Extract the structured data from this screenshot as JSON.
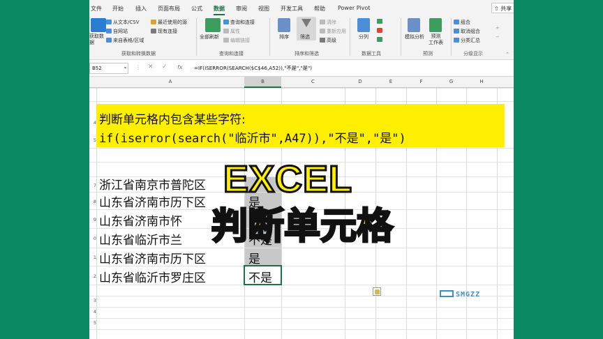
{
  "ribbon_tabs": [
    "文件",
    "开始",
    "插入",
    "页面布局",
    "公式",
    "数据",
    "审阅",
    "视图",
    "开发工具",
    "帮助",
    "Power Pivot"
  ],
  "active_tab": "数据",
  "share_label": "共享",
  "ribbon": {
    "get_data_big": "获取数\n据",
    "from_text_csv": "从文本/CSV",
    "from_web": "自网站",
    "from_table": "来自表格/区域",
    "recent_sources": "最近使用的源",
    "existing_connections": "现有连接",
    "group_get_transform": "获取和转换数据",
    "refresh_all": "全部刷新",
    "queries_connections": "查询和连接",
    "properties": "属性",
    "edit_links": "编辑链接",
    "group_queries": "查询和连接",
    "sort": "排序",
    "filter": "筛选",
    "clear": "清除",
    "reapply": "重新应用",
    "advanced": "高级",
    "group_sort_filter": "排序和筛选",
    "text_to_columns": "分列",
    "group_data_tools": "数据工具",
    "what_if": "模拟分析",
    "forecast_sheet": "预测\n工作表",
    "group_forecast": "预测",
    "group": "组合",
    "ungroup": "取消组合",
    "subtotal": "分类汇总",
    "group_outline": "分级显示"
  },
  "name_box": "B52",
  "formula_bar": {
    "fx": "fx",
    "formula": "=IF(ISERROR(SEARCH($C$46,A52)),\"不是\",\"是\")"
  },
  "columns": [
    "A",
    "B",
    "C",
    "D",
    "E",
    "F",
    "G",
    "H"
  ],
  "row_numbers": [
    "4",
    "5",
    "7",
    "8",
    "9",
    "0",
    "1",
    "2",
    "3",
    "4",
    "5"
  ],
  "yellow_line1": "判断单元格内包含某些字符:",
  "yellow_line2": "if(iserror(search(\"临沂市\",A47)),\"不是\",\"是\")",
  "rows": [
    {
      "a": "浙江省南京市普陀区",
      "b": ""
    },
    {
      "a": "山东省济南市历下区",
      "b": "是"
    },
    {
      "a": "山东省济南市怀",
      "b": ""
    },
    {
      "a": "山东省临沂市兰",
      "b": "不是"
    },
    {
      "a": "山东省济南市历下区",
      "b": "是"
    },
    {
      "a": "山东省临沂市罗庄区",
      "b": "不是"
    }
  ],
  "overlay_title": "EXCEL",
  "overlay_subtitle": "判断单元格",
  "watermark": "SMGZZ",
  "colors": {
    "accent": "#1e7145",
    "highlight": "#ffef00",
    "background": "#0b8a62"
  }
}
